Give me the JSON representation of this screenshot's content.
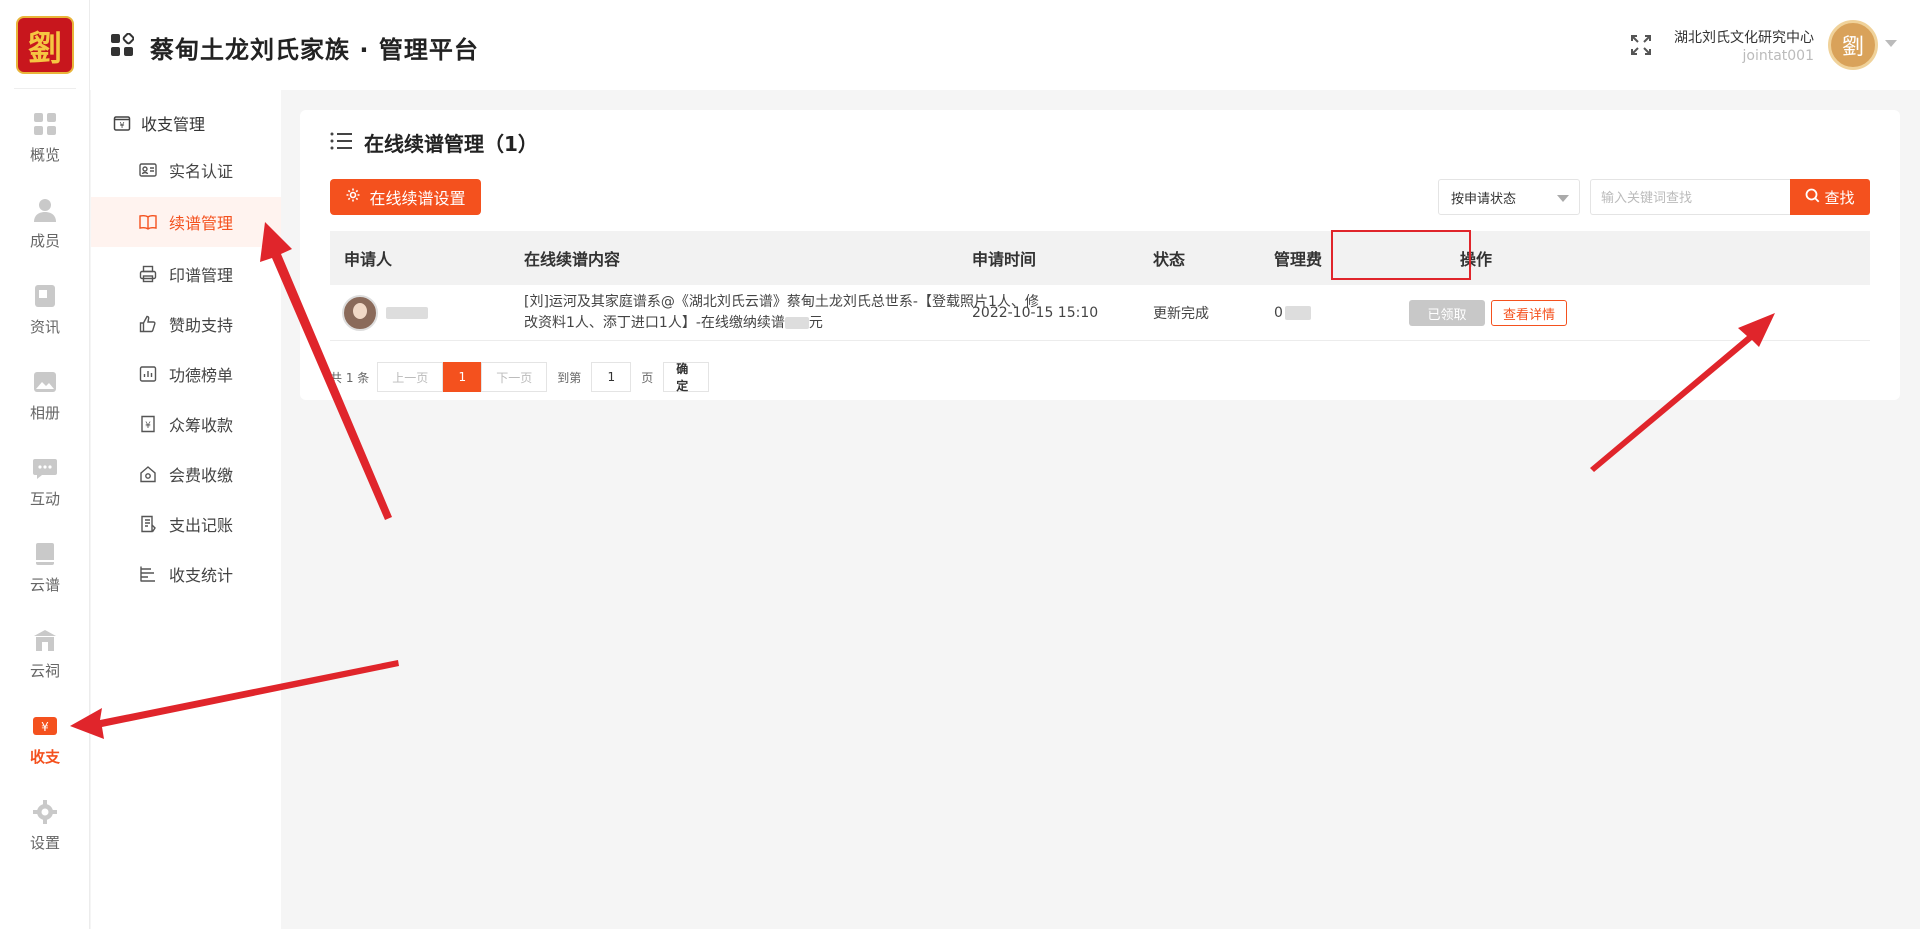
{
  "app": {
    "logo_char": "劉",
    "title": "蔡甸土龙刘氏家族 · 管理平台"
  },
  "rail": [
    {
      "label": "概览",
      "icon": "grid-icon"
    },
    {
      "label": "成员",
      "icon": "user-icon"
    },
    {
      "label": "资讯",
      "icon": "news-icon"
    },
    {
      "label": "相册",
      "icon": "image-icon"
    },
    {
      "label": "互动",
      "icon": "chat-icon"
    },
    {
      "label": "云谱",
      "icon": "book-icon"
    },
    {
      "label": "云祠",
      "icon": "temple-icon"
    },
    {
      "label": "收支",
      "icon": "yuan-icon",
      "active": true
    },
    {
      "label": "设置",
      "icon": "gear-icon"
    }
  ],
  "header": {
    "org_name": "湖北刘氏文化研究中心",
    "user_id": "jointat001",
    "avatar_char": "劉"
  },
  "submenu": {
    "group_label": "收支管理",
    "items": [
      {
        "label": "实名认证",
        "icon": "id-card-icon"
      },
      {
        "label": "续谱管理",
        "icon": "open-book-icon",
        "active": true
      },
      {
        "label": "印谱管理",
        "icon": "printer-icon"
      },
      {
        "label": "赞助支持",
        "icon": "thumb-up-icon"
      },
      {
        "label": "功德榜单",
        "icon": "list-chart-icon"
      },
      {
        "label": "众筹收款",
        "icon": "yuan-doc-icon"
      },
      {
        "label": "会费收缴",
        "icon": "house-icon"
      },
      {
        "label": "支出记账",
        "icon": "ledger-icon"
      },
      {
        "label": "收支统计",
        "icon": "stats-icon"
      }
    ]
  },
  "main": {
    "title": "在线续谱管理（1）",
    "settings_button": "在线续谱设置",
    "filter_select": "按申请状态",
    "search_placeholder": "输入关键词查找",
    "search_button": "查找"
  },
  "table": {
    "columns": [
      "申请人",
      "在线续谱内容",
      "申请时间",
      "状态",
      "管理费",
      "操作"
    ],
    "rows": [
      {
        "content_line1": "[刘]运河及其家庭谱系@《湖北刘氏云谱》蔡甸土龙刘氏总世系-【登载照片1人、修",
        "content_line2": "改资料1人、添丁进口1人】-在线缴纳续谱",
        "content_suffix": "元",
        "time": "2022-10-15 15:10",
        "status": "更新完成",
        "fee_prefix": "0",
        "action_claimed": "已领取",
        "action_detail": "查看详情"
      }
    ]
  },
  "pager": {
    "total": "共 1 条",
    "prev": "上一页",
    "current": "1",
    "next": "下一页",
    "goto": "到第",
    "page_input": "1",
    "page_unit": "页",
    "confirm": "确定"
  },
  "colors": {
    "accent": "#f4511e",
    "annotation": "#e0252b"
  }
}
